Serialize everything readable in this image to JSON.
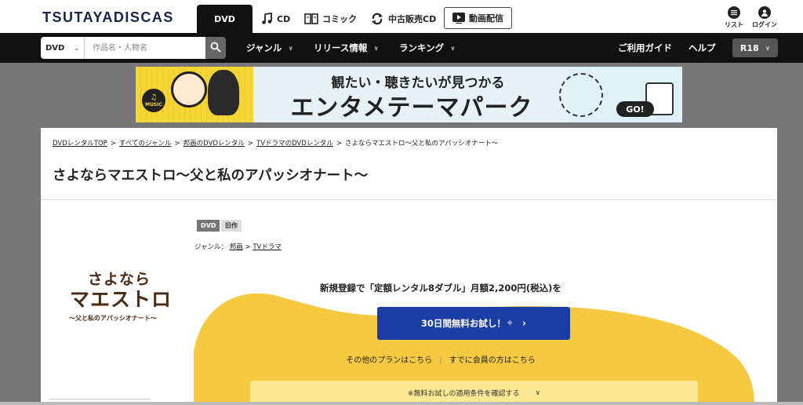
{
  "header": {
    "logo": "TSUTAYADISCAS",
    "tabs": [
      {
        "label": "DVD",
        "icon": "dvd"
      },
      {
        "label": "CD",
        "icon": "music-note-icon"
      },
      {
        "label": "コミック",
        "icon": "book-icon"
      },
      {
        "label": "中古販売CD",
        "icon": "recycle-icon"
      },
      {
        "label": "動画配信",
        "icon": "play-icon"
      }
    ],
    "list_label": "リスト",
    "login_label": "ログイン"
  },
  "nav": {
    "search_category": "DVD",
    "search_placeholder": "作品名・人物名",
    "items": [
      "ジャンル",
      "リリース情報",
      "ランキング"
    ],
    "guide": "ご利用ガイド",
    "help": "ヘルプ",
    "r18": "R18"
  },
  "banner": {
    "line1": "観たい・聴きたいが見つかる",
    "line2": "エンタメテーマパーク",
    "go": "GO!",
    "badge": "MUSIC"
  },
  "breadcrumb": [
    "DVDレンタルTOP",
    "すべてのジャンル",
    "邦画のDVDレンタル",
    "TVドラマのDVDレンタル",
    "さよならマエストロ〜父と私のアパッシオナート〜"
  ],
  "product": {
    "title": "さよならマエストロ〜父と私のアパッシオナート〜",
    "jacket_line1": "さよなら",
    "jacket_line2": "マエストロ",
    "jacket_line3": "〜父と私のアパッシオナート〜",
    "tag_format": "DVD",
    "tag_status": "旧作",
    "genre_prefix": "ジャンル：",
    "genre_1": "邦画",
    "genre_sep": ">",
    "genre_2": "TVドラマ"
  },
  "offer": {
    "text": "新規登録で「定額レンタル8ダブル」月額2,200円(税込)を",
    "button": "30日間無料お試し！",
    "button_note": "※",
    "other_plans": "その他のプランはこちら",
    "member": "すでに会員の方はこちら",
    "conditions": "※無料お試しの適用条件を確認する"
  },
  "colors": {
    "nav_bg": "#111111",
    "primary_button": "#1a3ea6",
    "banner_yellow": "#f6d636",
    "wave_yellow": "#f7c940"
  }
}
